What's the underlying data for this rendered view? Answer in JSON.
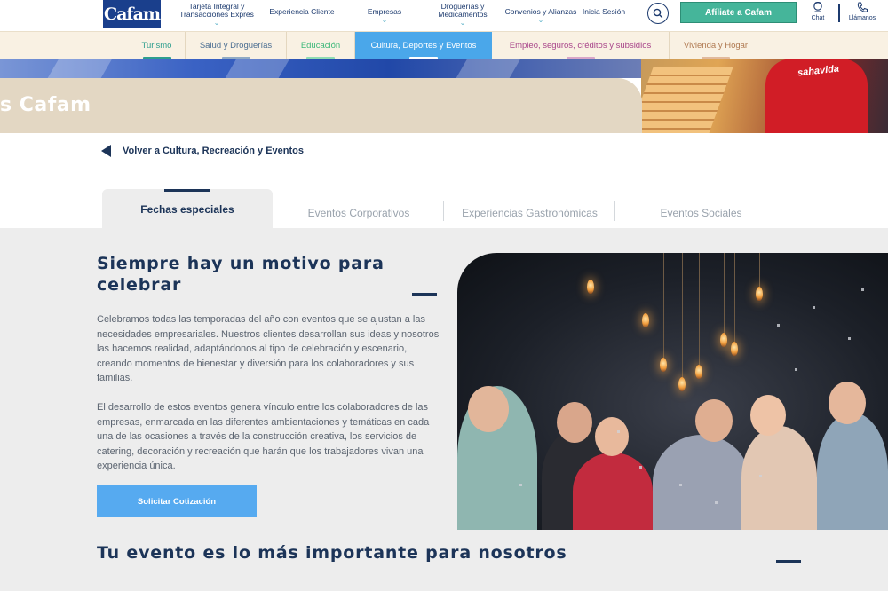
{
  "logo": {
    "text": "Cafam"
  },
  "nav": {
    "items": [
      {
        "label": "Tarjeta Integral y Transacciones Exprés",
        "chevron": "⌄"
      },
      {
        "label": "Experiencia Cliente",
        "chevron": ""
      },
      {
        "label": "Empresas",
        "chevron": "⌄"
      },
      {
        "label": "Droguerías y Medicamentos",
        "chevron": "⌄"
      },
      {
        "label": "Convenios y Alianzas",
        "chevron": "⌄"
      },
      {
        "label": "Inicia Sesión",
        "chevron": ""
      }
    ],
    "search_icon": "search-icon",
    "afiliate_label": "Afíliate a Cafam",
    "chat_label": "Chat",
    "call_label": "Llámanos"
  },
  "categories": [
    {
      "label": "Turismo",
      "color": "#2e9e8e"
    },
    {
      "label": "Salud y Droguerías",
      "color": "#5b7f9e"
    },
    {
      "label": "Educación",
      "color": "#4cc489"
    },
    {
      "label": "Cultura, Deportes y Eventos",
      "color": "#4aa7ea"
    },
    {
      "label": "Empleo, seguros, créditos y subsidios",
      "color": "#b04a8c"
    },
    {
      "label": "Vivienda y Hogar",
      "color": "#c88a5a"
    }
  ],
  "hero": {
    "title": "s Cafam",
    "photo_caption": "sahavida"
  },
  "back_link": {
    "label": "Volver a Cultura, Recreación y Eventos"
  },
  "tabs": [
    {
      "label": "Fechas especiales",
      "active": true
    },
    {
      "label": "Eventos Corporativos",
      "active": false
    },
    {
      "label": "Experiencias Gastronómicas",
      "active": false
    },
    {
      "label": "Eventos Sociales",
      "active": false
    }
  ],
  "section": {
    "heading": "Siempre hay un motivo para celebrar",
    "paragraph_1": "Celebramos todas las temporadas del año con eventos que se ajustan a las necesidades empresariales. Nuestros clientes desarrollan sus ideas y nosotros las hacemos realidad, adaptándonos al tipo de celebración y escenario, creando momentos de bienestar y diversión para los colaboradores y sus familias.",
    "paragraph_2": "El desarrollo de estos eventos genera vínculo entre los colaboradores de las empresas, enmarcada en las diferentes ambientaciones y temáticas en cada una de las ocasiones a través de la construcción creativa, los servicios de catering, decoración y recreación que harán que los trabajadores vivan una experiencia única.",
    "cta_label": "Solicitar Cotización"
  },
  "section_2": {
    "heading": "Tu evento es lo más importante para nosotros"
  }
}
